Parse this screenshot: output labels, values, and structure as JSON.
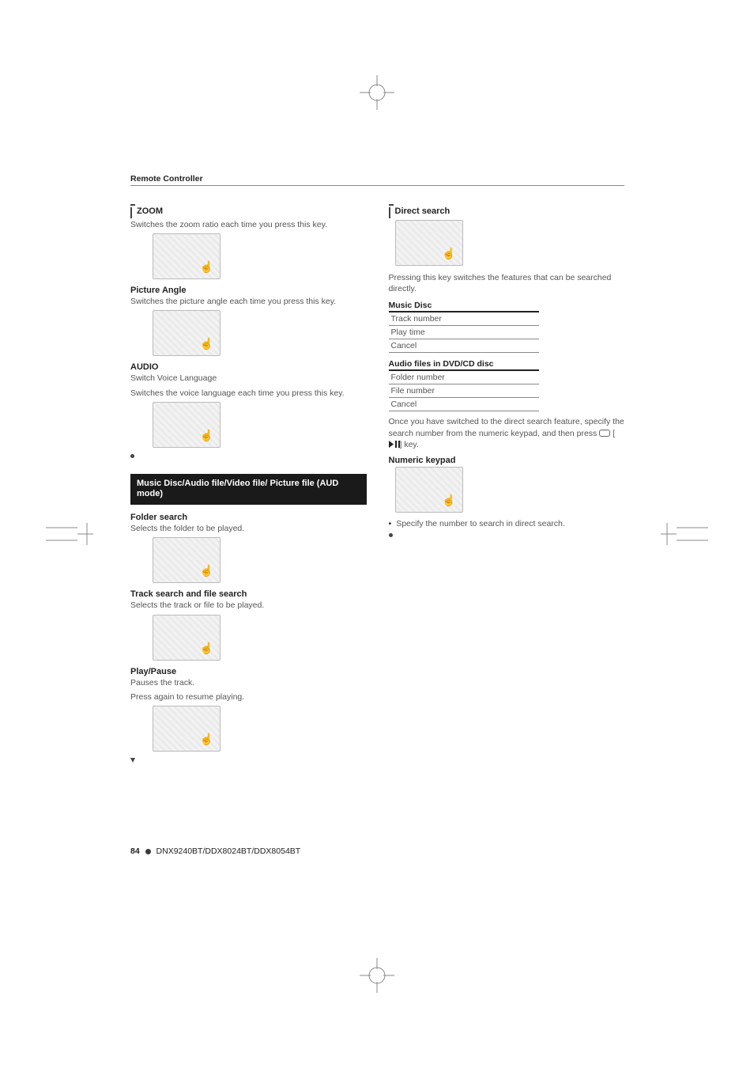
{
  "running_head": "Remote Controller",
  "left": {
    "zoom": {
      "title": "ZOOM",
      "body": "Switches the zoom ratio each time you press this key."
    },
    "picture_angle": {
      "title": "Picture Angle",
      "body": "Switches the picture angle each time you press this key."
    },
    "audio": {
      "title": "AUDIO",
      "sub": "Switch Voice Language",
      "body": "Switches the voice language each time you press this key."
    },
    "mode_box": "Music Disc/Audio file/Video file/ Picture file (AUD mode)",
    "folder_search": {
      "title": "Folder search",
      "body": "Selects the folder to be played."
    },
    "track_search": {
      "title": "Track search and file search",
      "body": "Selects the track or file to be played."
    },
    "play_pause": {
      "title": "Play/Pause",
      "l1": "Pauses the track.",
      "l2": "Press again to resume playing."
    }
  },
  "right": {
    "direct_search": {
      "title": "Direct search",
      "body": "Pressing this key switches the features that can be searched directly."
    },
    "music_disc": {
      "head": "Music Disc",
      "rows": [
        "Track number",
        "Play time",
        "Cancel"
      ]
    },
    "audio_files": {
      "head": "Audio files in DVD/CD disc",
      "rows": [
        "Folder number",
        "File number",
        "Cancel"
      ]
    },
    "after_switch_a": "Once you have switched to the direct search feature, specify the search number from the numeric keypad, and then press ",
    "after_switch_b": " [",
    "after_switch_c": "] key.",
    "numeric_keypad": {
      "title": "Numeric keypad",
      "bullet": "Specify the number to search in direct search."
    }
  },
  "footer": {
    "page": "84",
    "models": "DNX9240BT/DDX8024BT/DDX8054BT"
  }
}
